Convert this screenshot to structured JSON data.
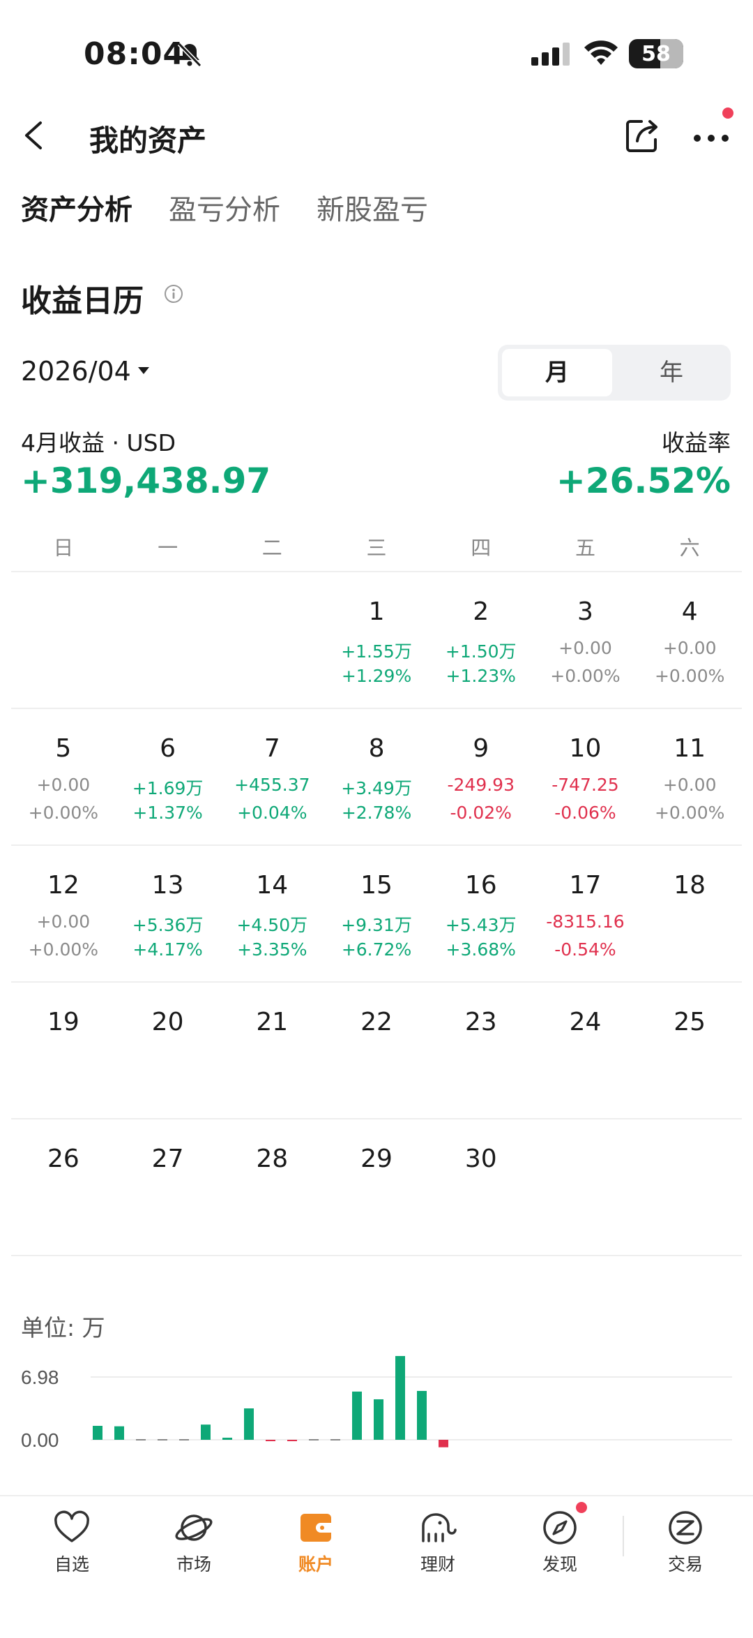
{
  "status_bar": {
    "time": "08:04",
    "battery_level": "58",
    "battery_fraction": 0.58
  },
  "header": {
    "title": "我的资产"
  },
  "tabs": [
    {
      "label": "资产分析",
      "active": true
    },
    {
      "label": "盈亏分析",
      "active": false
    },
    {
      "label": "新股盈亏",
      "active": false
    }
  ],
  "section": {
    "title": "收益日历"
  },
  "date_selector": {
    "value": "2026/04"
  },
  "period_toggle": {
    "month": "月",
    "year": "年",
    "selected": "月"
  },
  "summary": {
    "label": "4月收益 · USD",
    "value": "+319,438.97",
    "rate_label": "收益率",
    "rate": "+26.52%"
  },
  "calendar": {
    "weekdays": [
      "日",
      "一",
      "二",
      "三",
      "四",
      "五",
      "六"
    ],
    "weeks": [
      [
        {
          "day": "",
          "amt": "",
          "pct": "",
          "tone": "zero"
        },
        {
          "day": "",
          "amt": "",
          "pct": "",
          "tone": "zero"
        },
        {
          "day": "",
          "amt": "",
          "pct": "",
          "tone": "zero"
        },
        {
          "day": "1",
          "amt": "+1.55万",
          "pct": "+1.29%",
          "tone": "pos"
        },
        {
          "day": "2",
          "amt": "+1.50万",
          "pct": "+1.23%",
          "tone": "pos"
        },
        {
          "day": "3",
          "amt": "+0.00",
          "pct": "+0.00%",
          "tone": "zero"
        },
        {
          "day": "4",
          "amt": "+0.00",
          "pct": "+0.00%",
          "tone": "zero"
        }
      ],
      [
        {
          "day": "5",
          "amt": "+0.00",
          "pct": "+0.00%",
          "tone": "zero"
        },
        {
          "day": "6",
          "amt": "+1.69万",
          "pct": "+1.37%",
          "tone": "pos"
        },
        {
          "day": "7",
          "amt": "+455.37",
          "pct": "+0.04%",
          "tone": "pos"
        },
        {
          "day": "8",
          "amt": "+3.49万",
          "pct": "+2.78%",
          "tone": "pos"
        },
        {
          "day": "9",
          "amt": "-249.93",
          "pct": "-0.02%",
          "tone": "neg"
        },
        {
          "day": "10",
          "amt": "-747.25",
          "pct": "-0.06%",
          "tone": "neg"
        },
        {
          "day": "11",
          "amt": "+0.00",
          "pct": "+0.00%",
          "tone": "zero"
        }
      ],
      [
        {
          "day": "12",
          "amt": "+0.00",
          "pct": "+0.00%",
          "tone": "zero"
        },
        {
          "day": "13",
          "amt": "+5.36万",
          "pct": "+4.17%",
          "tone": "pos"
        },
        {
          "day": "14",
          "amt": "+4.50万",
          "pct": "+3.35%",
          "tone": "pos"
        },
        {
          "day": "15",
          "amt": "+9.31万",
          "pct": "+6.72%",
          "tone": "pos"
        },
        {
          "day": "16",
          "amt": "+5.43万",
          "pct": "+3.68%",
          "tone": "pos"
        },
        {
          "day": "17",
          "amt": "-8315.16",
          "pct": "-0.54%",
          "tone": "neg"
        },
        {
          "day": "18",
          "amt": "",
          "pct": "",
          "tone": "zero"
        }
      ],
      [
        {
          "day": "19",
          "amt": "",
          "pct": "",
          "tone": "zero"
        },
        {
          "day": "20",
          "amt": "",
          "pct": "",
          "tone": "zero"
        },
        {
          "day": "21",
          "amt": "",
          "pct": "",
          "tone": "zero"
        },
        {
          "day": "22",
          "amt": "",
          "pct": "",
          "tone": "zero"
        },
        {
          "day": "23",
          "amt": "",
          "pct": "",
          "tone": "zero"
        },
        {
          "day": "24",
          "amt": "",
          "pct": "",
          "tone": "zero"
        },
        {
          "day": "25",
          "amt": "",
          "pct": "",
          "tone": "zero"
        }
      ],
      [
        {
          "day": "26",
          "amt": "",
          "pct": "",
          "tone": "zero"
        },
        {
          "day": "27",
          "amt": "",
          "pct": "",
          "tone": "zero"
        },
        {
          "day": "28",
          "amt": "",
          "pct": "",
          "tone": "zero"
        },
        {
          "day": "29",
          "amt": "",
          "pct": "",
          "tone": "zero"
        },
        {
          "day": "30",
          "amt": "",
          "pct": "",
          "tone": "zero"
        },
        {
          "day": "",
          "amt": "",
          "pct": "",
          "tone": "zero"
        },
        {
          "day": "",
          "amt": "",
          "pct": "",
          "tone": "zero"
        }
      ]
    ]
  },
  "chart_data": {
    "type": "bar",
    "unit_label": "单位: 万",
    "y_ticks": [
      "6.98",
      "0.00"
    ],
    "ylim": [
      -1,
      7.5
    ],
    "categories": [
      "1",
      "2",
      "3",
      "4",
      "5",
      "6",
      "7",
      "8",
      "9",
      "10",
      "11",
      "12",
      "13",
      "14",
      "15",
      "16",
      "17"
    ],
    "values": [
      1.55,
      1.5,
      0.0,
      0.0,
      0.0,
      1.69,
      0.05,
      3.49,
      -0.02,
      -0.07,
      0.0,
      0.0,
      5.36,
      4.5,
      9.31,
      5.43,
      -0.83
    ],
    "colors": {
      "positive": "#0ea877",
      "negative": "#e0304d",
      "zero": "#888888"
    }
  },
  "bottom_nav": [
    {
      "label": "自选",
      "icon": "heart-icon",
      "active": false
    },
    {
      "label": "市场",
      "icon": "planet-icon",
      "active": false
    },
    {
      "label": "账户",
      "icon": "wallet-icon",
      "active": true
    },
    {
      "label": "理财",
      "icon": "elephant-icon",
      "active": false
    },
    {
      "label": "发现",
      "icon": "compass-icon",
      "active": false
    },
    {
      "label": "交易",
      "icon": "trade-icon",
      "active": false
    }
  ],
  "colors": {
    "accent": "#f08a24",
    "positive": "#0ea877",
    "negative": "#e0304d",
    "badge": "#f0405a"
  }
}
